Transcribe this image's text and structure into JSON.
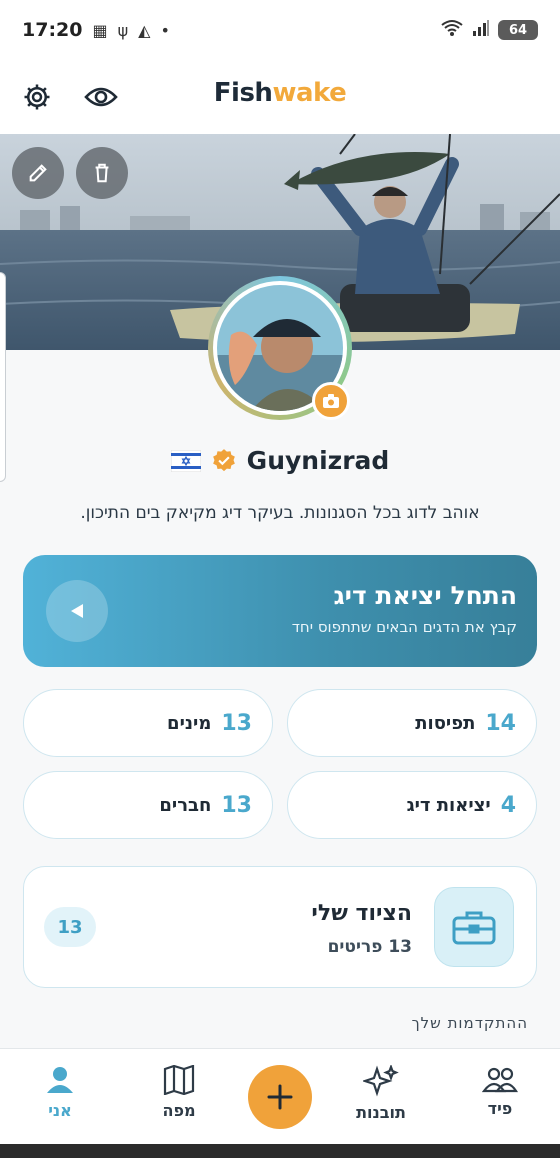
{
  "status_bar": {
    "time": "17:20",
    "battery": "64",
    "wifi_label": "5"
  },
  "app": {
    "logo_part1": "Fish",
    "logo_part2": "wake"
  },
  "profile": {
    "username": "Guynizrad",
    "bio": "אוהב לדוג בכל הסגנונות. בעיקר דיג מקיאק בים התיכון."
  },
  "trip_card": {
    "title": "התחל יציאת דיג",
    "subtitle": "קבץ את הדגים הבאים שתתפוס יחד"
  },
  "stats": [
    {
      "id": "catches",
      "value": "14",
      "label": "תפיסות"
    },
    {
      "id": "species",
      "value": "13",
      "label": "מינים"
    },
    {
      "id": "trips",
      "value": "4",
      "label": "יציאות דיג"
    },
    {
      "id": "friends",
      "value": "13",
      "label": "חברים"
    }
  ],
  "gear": {
    "title": "הציוד שלי",
    "subtitle": "13 פריטים",
    "count": "13"
  },
  "progress_heading": "ההתקדמות שלך",
  "nav": [
    {
      "id": "feed",
      "label": "פיד",
      "icon": "users-icon"
    },
    {
      "id": "insights",
      "label": "תובנות",
      "icon": "sparkles-icon"
    },
    {
      "id": "add",
      "label": "+",
      "icon": "plus-icon"
    },
    {
      "id": "map",
      "label": "מפה",
      "icon": "map-icon"
    },
    {
      "id": "me",
      "label": "אני",
      "icon": "user-icon",
      "active": true
    }
  ],
  "colors": {
    "accent_blue": "#4aa8cc",
    "accent_orange": "#f0a23a",
    "text_dark": "#1f2a35"
  }
}
